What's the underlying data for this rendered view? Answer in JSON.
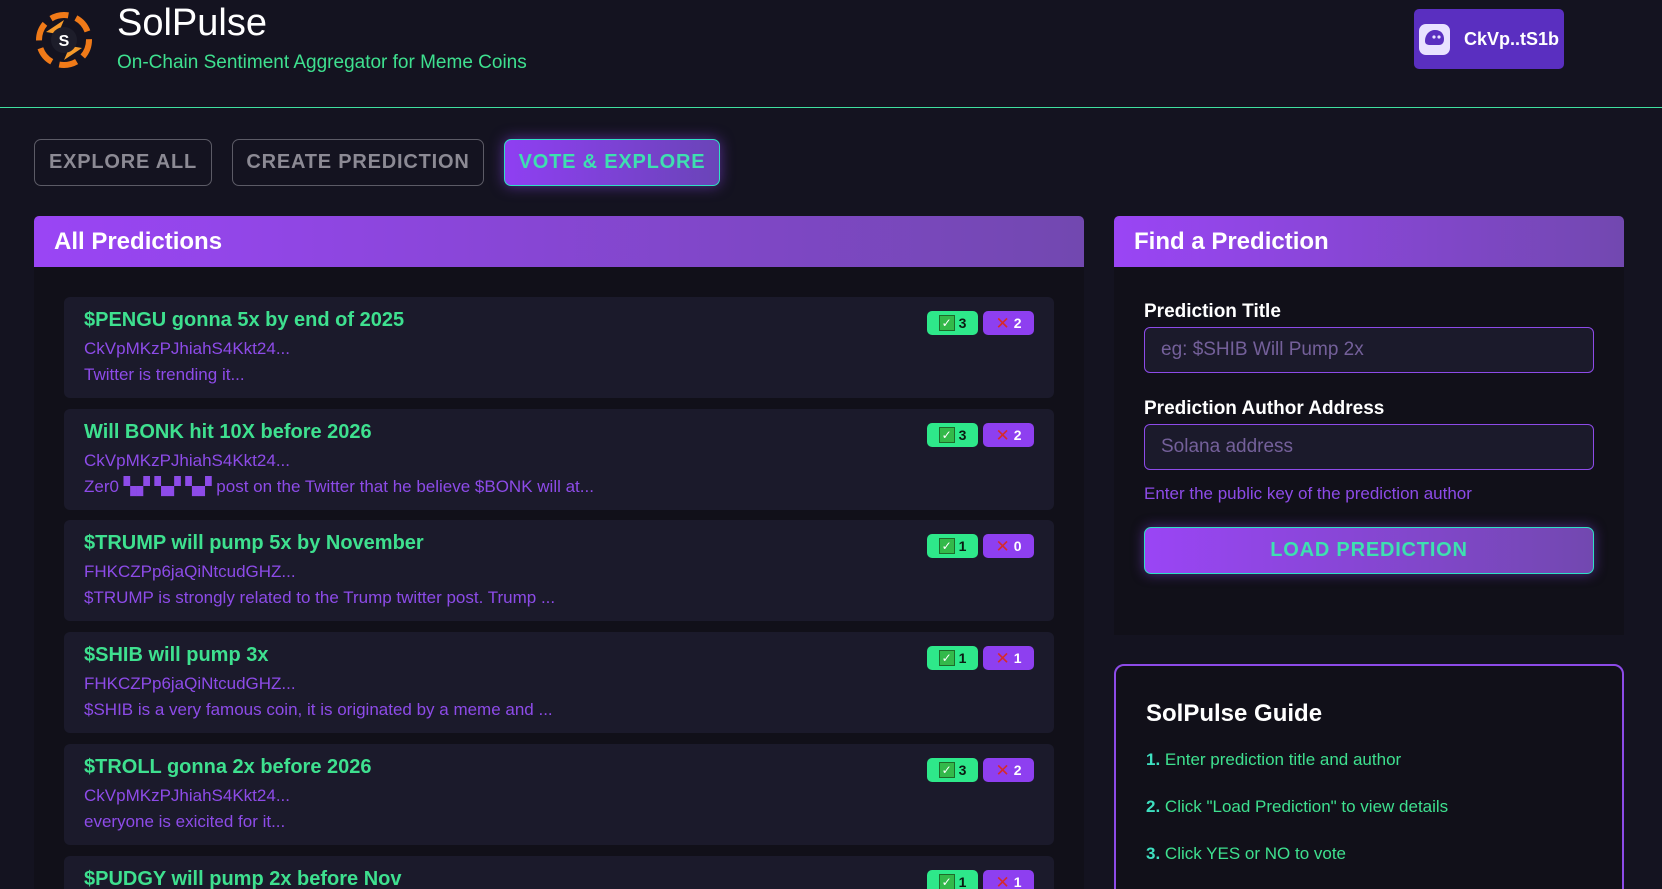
{
  "header": {
    "title": "SolPulse",
    "subtitle": "On-Chain Sentiment Aggregator for Meme Coins",
    "wallet_label": "CkVp..tS1b",
    "accent": "#3ee08f",
    "wallet_color": "#5a2fc0"
  },
  "tabs": [
    {
      "label": "EXPLORE ALL",
      "active": false
    },
    {
      "label": "CREATE PREDICTION",
      "active": false
    },
    {
      "label": "VOTE & EXPLORE",
      "active": true
    }
  ],
  "predictions_panel": {
    "title": "All Predictions",
    "items": [
      {
        "title": "$PENGU gonna 5x by end of 2025",
        "author": "CkVpMKzPJhiahS4Kkt24...",
        "description": "Twitter is trending it...",
        "yes": "3",
        "no": "2"
      },
      {
        "title": "Will BONK hit 10X before 2026",
        "author": "CkVpMKzPJhiahS4Kkt24...",
        "description": "Zer0 ▚▞ ▚▞ ▚▞ post on the Twitter that he believe $BONK will at...",
        "yes": "3",
        "no": "2"
      },
      {
        "title": "$TRUMP will pump 5x by November",
        "author": "FHKCZPp6jaQiNtcudGHZ...",
        "description": "$TRUMP is strongly related to the Trump twitter post. Trump ...",
        "yes": "1",
        "no": "0"
      },
      {
        "title": "$SHIB will pump 3x",
        "author": "FHKCZPp6jaQiNtcudGHZ...",
        "description": "$SHIB is a very famous coin, it is originated by a meme and ...",
        "yes": "1",
        "no": "1"
      },
      {
        "title": "$TROLL gonna 2x before 2026",
        "author": "CkVpMKzPJhiahS4Kkt24...",
        "description": "everyone is exicited for it...",
        "yes": "3",
        "no": "2"
      },
      {
        "title": "$PUDGY will pump 2x before Nov",
        "author": "",
        "description": "",
        "yes": "1",
        "no": "1"
      }
    ]
  },
  "find_panel": {
    "title": "Find a Prediction",
    "title_label": "Prediction Title",
    "title_placeholder": "eg: $SHIB Will Pump 2x",
    "author_label": "Prediction Author Address",
    "author_placeholder": "Solana address",
    "hint": "Enter the public key of the prediction author",
    "button_label": "LOAD PREDICTION"
  },
  "guide": {
    "title": "SolPulse Guide",
    "steps": [
      {
        "num": "1.",
        "text": "Enter prediction title and author"
      },
      {
        "num": "2.",
        "text": "Click \"Load Prediction\" to view details"
      },
      {
        "num": "3.",
        "text": "Click YES or NO to vote"
      }
    ]
  }
}
